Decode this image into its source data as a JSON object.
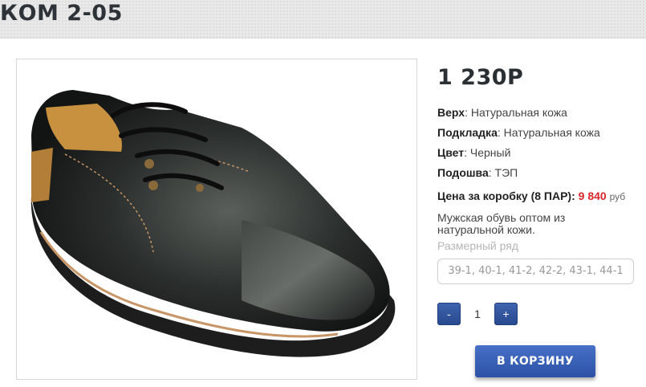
{
  "page": {
    "title": "КОМ 2-05"
  },
  "product": {
    "image_alt": "black leather shoe",
    "price": "1 230Р",
    "specs": [
      {
        "label": "Верх",
        "value": "Натуральная кожа"
      },
      {
        "label": "Подкладка",
        "value": "Натуральная кожа"
      },
      {
        "label": "Цвет",
        "value": "Черный"
      },
      {
        "label": "Подошва",
        "value": "ТЭП"
      }
    ],
    "box_price": {
      "label": "Цена за коробку (8 ПАР)",
      "value": "9 840",
      "unit": "руб"
    },
    "description": "Мужская обувь оптом из натуральной кожи.",
    "size_label": "Размерный ряд",
    "sizes": "39-1, 40-1, 41-2, 42-2, 43-1, 44-1"
  },
  "quantity": {
    "minus": "-",
    "value": "1",
    "plus": "+"
  },
  "cart_button": "В КОРЗИНУ",
  "colors": {
    "accent": "#2b52a6",
    "price_red": "#d9262b"
  }
}
